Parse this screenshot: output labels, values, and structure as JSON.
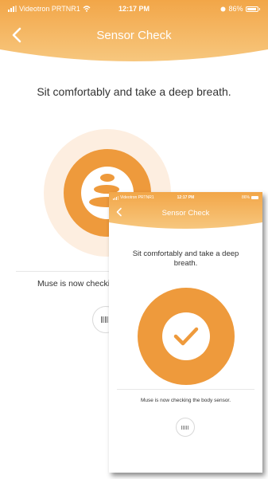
{
  "main": {
    "status_bar": {
      "carrier": "Videotron PRTNR1",
      "time": "12:17 PM",
      "battery": "86%"
    },
    "header": {
      "title": "Sensor Check",
      "back_icon": "chevron-left-icon"
    },
    "prompt": "Sit comfortably and take a deep breath.",
    "status_text": "Muse is now checking the body sensor.",
    "sensor_button_icon": "headset-icon",
    "center_icon": "stacked-stones-icon"
  },
  "overlay": {
    "status_bar": {
      "carrier": "Videotron PRTNR1",
      "time": "12:17 PM",
      "battery": "86%"
    },
    "header": {
      "title": "Sensor Check",
      "back_icon": "chevron-left-icon"
    },
    "prompt": "Sit comfortably and take a deep breath.",
    "status_text": "Muse is now checking the body sensor.",
    "center_icon": "checkmark-icon",
    "sensor_button_icon": "headset-icon"
  },
  "colors": {
    "accent": "#EE9A3C",
    "accent_light": "#FDEEE0",
    "header_gradient_top": "#F2A648",
    "header_gradient_bottom": "#F7C77E",
    "text": "#333333"
  }
}
